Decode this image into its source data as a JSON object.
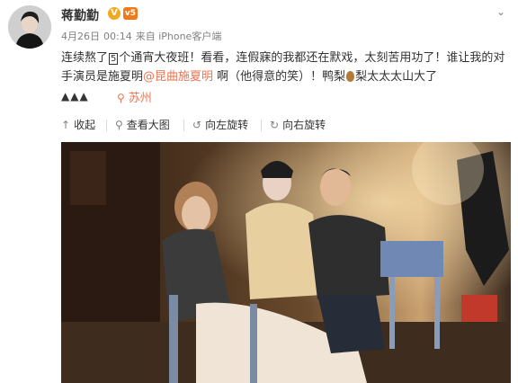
{
  "post": {
    "username": "蒋勤勤",
    "verified_badge": "V",
    "vip_badge": "v5",
    "date": "4月26日",
    "time": "00:14",
    "source": "来自 iPhone客户端",
    "text": {
      "line1_a": "连续熬了",
      "boxed_number": "5",
      "line1_b": "个通宵大夜班！看看，连假寐的我都还在默戏，太刻苦用功了！谁让",
      "line2_a": "我的对手演员是施夏明",
      "mention": "@昆曲施夏明",
      "line2_b": " 啊（他得意的笑）！鸭梨",
      "line2_c": "梨太太太山大了"
    },
    "emoji_row": "▲▲▲",
    "location": "苏州"
  },
  "toolbar": {
    "collapse": "收起",
    "view_large": "查看大图",
    "rotate_left": "向左旋转",
    "rotate_right": "向右旋转"
  },
  "icons": {
    "collapse": "arrow-up-icon",
    "view_large": "magnifier-icon",
    "rotate_left": "rotate-left-icon",
    "rotate_right": "rotate-right-icon",
    "location": "location-pin-icon",
    "more": "chevron-down-icon"
  },
  "colors": {
    "link": "#eb7350",
    "text": "#333333",
    "meta": "#808080",
    "badge_v": "#f2a91d",
    "badge_vip": "#f07a1a"
  }
}
